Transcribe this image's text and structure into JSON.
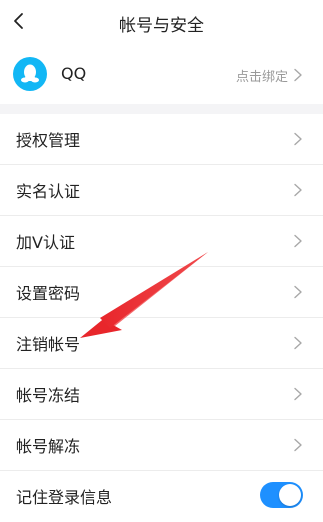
{
  "header": {
    "title": "帐号与安全",
    "back_icon": "chevron-left-icon"
  },
  "account": {
    "name": "QQ",
    "bind_hint": "点击绑定",
    "avatar_color": "#12b7f5"
  },
  "items": [
    {
      "label": "授权管理"
    },
    {
      "label": "实名认证"
    },
    {
      "label": "加V认证"
    },
    {
      "label": "设置密码"
    },
    {
      "label": "注销帐号"
    },
    {
      "label": "帐号冻结"
    },
    {
      "label": "帐号解冻"
    },
    {
      "label": "记住登录信息",
      "toggle_on": true
    }
  ],
  "colors": {
    "accent": "#1e90ff",
    "annotation_arrow": "#e8262b"
  }
}
